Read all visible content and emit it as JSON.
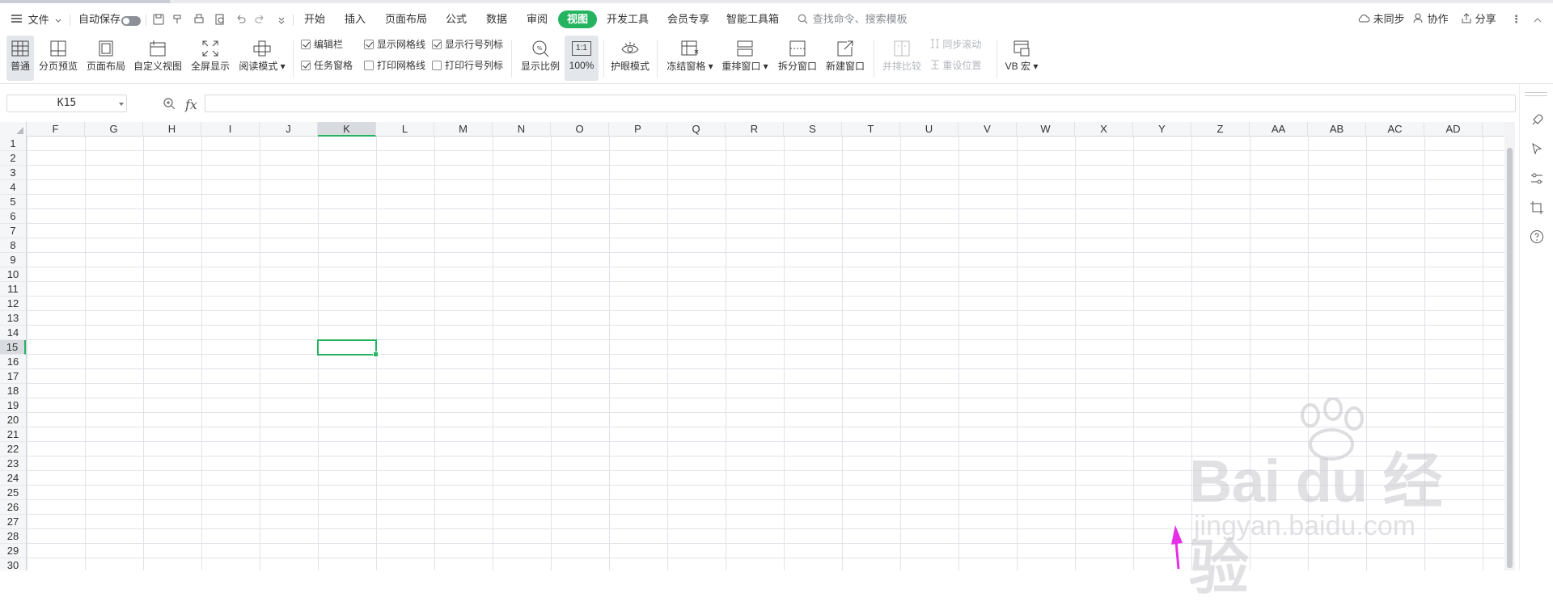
{
  "menubar": {
    "file_label": "文件",
    "autosave_label": "自动保存",
    "tabs": [
      "开始",
      "插入",
      "页面布局",
      "公式",
      "数据",
      "审阅",
      "视图",
      "开发工具",
      "会员专享",
      "智能工具箱"
    ],
    "active_tab": "视图",
    "search_placeholder": "查找命令、搜索模板",
    "sync_label": "未同步",
    "collab_label": "协作",
    "share_label": "分享"
  },
  "ribbon": {
    "view_buttons": [
      "普通",
      "分页预览",
      "页面布局",
      "自定义视图",
      "全屏显示",
      "阅读模式"
    ],
    "checkboxes": [
      {
        "label": "编辑栏",
        "checked": true
      },
      {
        "label": "任务窗格",
        "checked": true
      },
      {
        "label": "显示网格线",
        "checked": true
      },
      {
        "label": "打印网格线",
        "checked": false
      },
      {
        "label": "显示行号列标",
        "checked": true
      },
      {
        "label": "打印行号列标",
        "checked": false
      }
    ],
    "zoom_label": "显示比例",
    "zoom_100_label": "100%",
    "zoom_100_icon_text": "1:1",
    "eye_label": "护眼模式",
    "freeze_label": "冻结窗格",
    "rearrange_label": "重排窗口",
    "split_label": "拆分窗口",
    "new_window_label": "新建窗口",
    "side_by_side_label": "并排比较",
    "sync_scroll_label": "同步滚动",
    "reset_pos_label": "重设位置",
    "vb_label": "VB 宏"
  },
  "formula": {
    "cell_ref": "K15",
    "fx": "fx",
    "value": ""
  },
  "sheet": {
    "columns": [
      "F",
      "G",
      "H",
      "I",
      "J",
      "K",
      "L",
      "M",
      "N",
      "O",
      "P",
      "Q",
      "R",
      "S",
      "T",
      "U",
      "V",
      "W",
      "X",
      "Y",
      "Z",
      "AA",
      "AB",
      "AC",
      "AD"
    ],
    "rows": [
      "1",
      "2",
      "3",
      "4",
      "5",
      "6",
      "7",
      "8",
      "9",
      "10",
      "11",
      "12",
      "13",
      "14",
      "15",
      "16",
      "17",
      "18",
      "19",
      "20",
      "21",
      "22",
      "23",
      "24",
      "25",
      "26",
      "27",
      "28",
      "29",
      "30"
    ],
    "selected_column": "K",
    "selected_row": "15"
  },
  "watermark": {
    "logo_text": "Bai du 经验",
    "url": "jingyan.baidu.com"
  },
  "colors": {
    "accent": "#24b35f",
    "arrow": "#e62ee6"
  }
}
